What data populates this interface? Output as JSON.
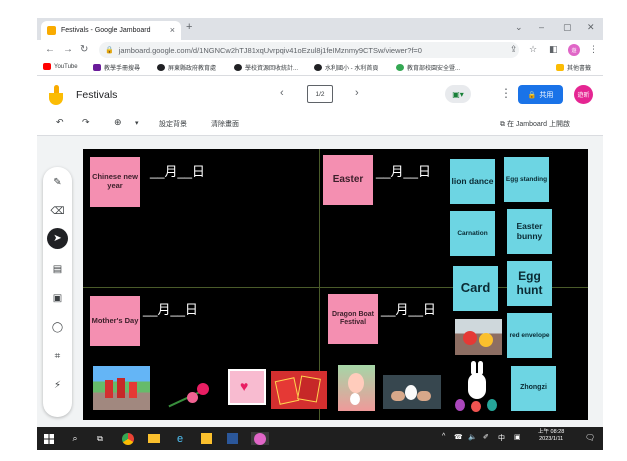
{
  "browser": {
    "tab_title": "Festivals - Google Jamboard",
    "tab_close": "×",
    "new_tab": "+",
    "url": "jamboard.google.com/d/1NGNCw2hTJ81xqUvrpqiv41oEzul8j1feIMznmy9CTSw/viewer?f=0",
    "win_min": "⌄",
    "win_minimize": "–",
    "win_restore": "▢",
    "win_close": "✕",
    "bookmarks": [
      "YouTube",
      "教學手冊搜尋",
      "屏東縣政府教育處",
      "學校資源回收統計...",
      "水利國小 - 水利首頁",
      "教育部校園安全暨...",
      "其他書籤"
    ]
  },
  "jamboard": {
    "title": "Festivals",
    "frame_counter": "1/2",
    "prev": "‹",
    "next": "›",
    "share_label": "共用",
    "avatar_label": "遊昕",
    "toolbar": {
      "set_background": "設定背景",
      "clear_frame": "清除畫面",
      "open_in_jamboard": "在 Jamboard 上開啟"
    }
  },
  "board": {
    "blank_date": "__月__日",
    "pink_notes": [
      {
        "id": "chinese-new-year",
        "text": "Chinese new year"
      },
      {
        "id": "easter",
        "text": "Easter"
      },
      {
        "id": "mothers-day",
        "text": "Mother's Day"
      },
      {
        "id": "dragon-boat",
        "text": "Dragon Boat Festival"
      }
    ],
    "cyan_notes": [
      {
        "id": "lion-dance",
        "text": "lion dance"
      },
      {
        "id": "egg-standing",
        "text": "Egg standing"
      },
      {
        "id": "carnation",
        "text": "Carnation"
      },
      {
        "id": "easter-bunny",
        "text": "Easter bunny"
      },
      {
        "id": "card",
        "text": "Card"
      },
      {
        "id": "egg-hunt",
        "text": "Egg hunt"
      },
      {
        "id": "red-envelope",
        "text": "red envelope"
      },
      {
        "id": "zhongzi",
        "text": "Zhongzi"
      }
    ]
  },
  "taskbar": {
    "lang_mode": "中",
    "time": "上午 08:28",
    "date": "2023/1/11"
  },
  "colors": {
    "board_bg": "#000000",
    "pink_note": "#f48fb1",
    "cyan_note": "#6dd5e3",
    "share_button": "#1a73e8"
  }
}
